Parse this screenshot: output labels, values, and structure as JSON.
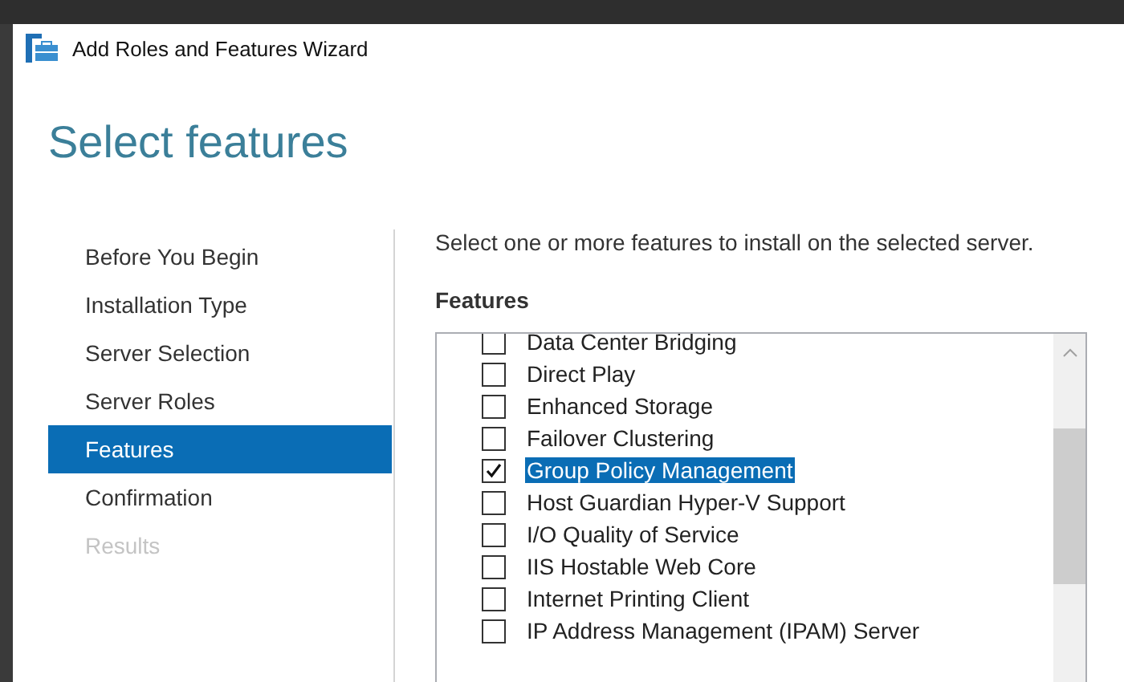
{
  "window": {
    "title": "Add Roles and Features Wizard"
  },
  "heading": "Select features",
  "steps": [
    {
      "label": "Before You Begin",
      "selected": false,
      "disabled": false
    },
    {
      "label": "Installation Type",
      "selected": false,
      "disabled": false
    },
    {
      "label": "Server Selection",
      "selected": false,
      "disabled": false
    },
    {
      "label": "Server Roles",
      "selected": false,
      "disabled": false
    },
    {
      "label": "Features",
      "selected": true,
      "disabled": false
    },
    {
      "label": "Confirmation",
      "selected": false,
      "disabled": false
    },
    {
      "label": "Results",
      "selected": false,
      "disabled": true
    }
  ],
  "description": "Select one or more features to install on the selected server.",
  "features_label": "Features",
  "features": [
    {
      "label": "Data Center Bridging",
      "checked": false,
      "selected": false
    },
    {
      "label": "Direct Play",
      "checked": false,
      "selected": false
    },
    {
      "label": "Enhanced Storage",
      "checked": false,
      "selected": false
    },
    {
      "label": "Failover Clustering",
      "checked": false,
      "selected": false
    },
    {
      "label": "Group Policy Management",
      "checked": true,
      "selected": true
    },
    {
      "label": "Host Guardian Hyper-V Support",
      "checked": false,
      "selected": false
    },
    {
      "label": "I/O Quality of Service",
      "checked": false,
      "selected": false
    },
    {
      "label": "IIS Hostable Web Core",
      "checked": false,
      "selected": false
    },
    {
      "label": "Internet Printing Client",
      "checked": false,
      "selected": false
    },
    {
      "label": "IP Address Management (IPAM) Server",
      "checked": false,
      "selected": false
    }
  ]
}
